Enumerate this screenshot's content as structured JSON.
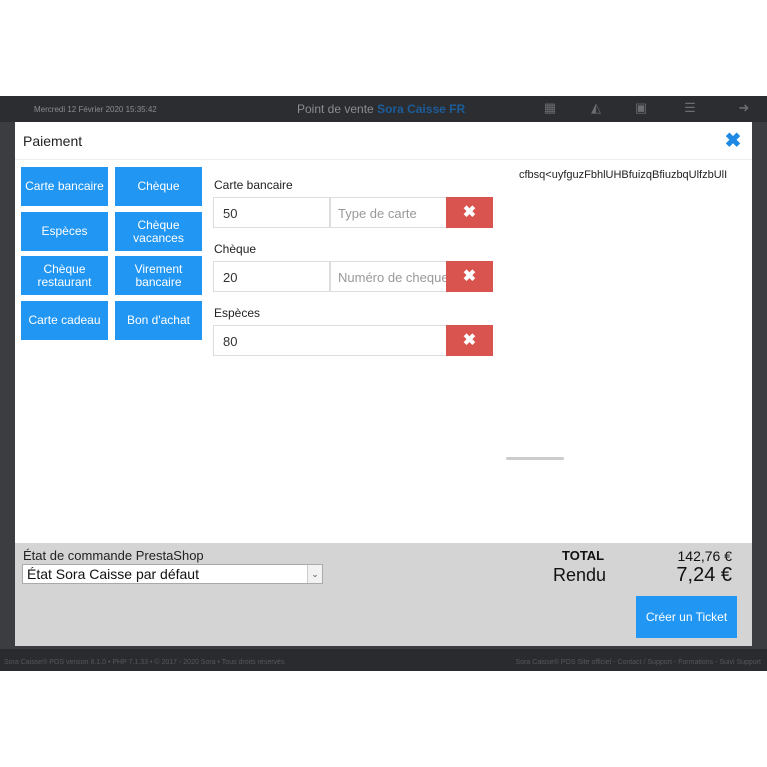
{
  "background": {
    "datetime": "Mercredi 12 Février 2020 15:35:42",
    "pos_prefix": "Point de vente",
    "pos_name": "Sora Caisse FR",
    "footer_left": "Sora Caisse® POS version 8.1.0 • PHP 7.1.33 • © 2017 - 2020 Sora • Tous droits réservés",
    "footer_right": "Sora Caisse® POS Site officiel - Contact / Support - Formations - Suivi Support"
  },
  "modal": {
    "title": "Paiement",
    "close_icon": "close-icon",
    "accent": "#2196f3",
    "delete_color": "#d9534f",
    "payment_methods": [
      "Carte bancaire",
      "Chèque",
      "Espèces",
      "Chèque vacances",
      "Chèque restaurant",
      "Virement bancaire",
      "Carte cadeau",
      "Bon d'achat"
    ],
    "payments": [
      {
        "label": "Carte bancaire",
        "amount": "50",
        "detail_placeholder": "Type de carte"
      },
      {
        "label": "Chèque",
        "amount": "20",
        "detail_placeholder": "Numéro de cheque"
      },
      {
        "label": "Espèces",
        "amount": "80"
      }
    ],
    "ticket_text": "cfbsq<uyfguzFbhlUHBfuizqBfiuzbqUlfzbUlI"
  },
  "footer": {
    "order_state_label": "État de commande PrestaShop",
    "order_state_value": "État Sora Caisse par défaut",
    "total_label": "TOTAL",
    "total_value": "142,76 €",
    "rendu_label": "Rendu",
    "rendu_value": "7,24 €",
    "create_ticket_label": "Créer un Ticket"
  }
}
